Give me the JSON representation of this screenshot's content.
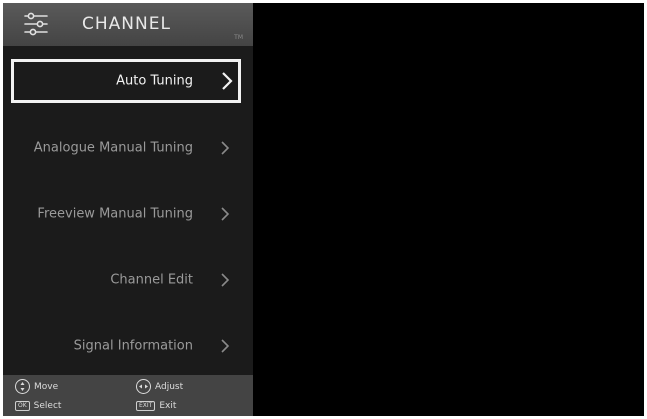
{
  "header": {
    "title": "CHANNEL",
    "tag": "TM",
    "icon": "settings-sliders-icon"
  },
  "menu": {
    "items": [
      {
        "label": "Auto Tuning",
        "selected": true
      },
      {
        "label": "Analogue Manual Tuning",
        "selected": false
      },
      {
        "label": "Freeview Manual Tuning",
        "selected": false
      },
      {
        "label": "Channel Edit",
        "selected": false
      },
      {
        "label": "Signal Information",
        "selected": false
      }
    ]
  },
  "footer": {
    "move_label": "Move",
    "adjust_label": "Adjust",
    "ok_key": "OK",
    "select_label": "Select",
    "exit_key": "EXIT",
    "exit_label": "Exit"
  },
  "colors": {
    "panel_bg": "#1b1b1b",
    "header_bg": "#4f4f4f",
    "footer_bg": "#444444",
    "screen_bg": "#000000",
    "selected_border": "#f2f2f2",
    "item_text": "#9a9a9a"
  }
}
